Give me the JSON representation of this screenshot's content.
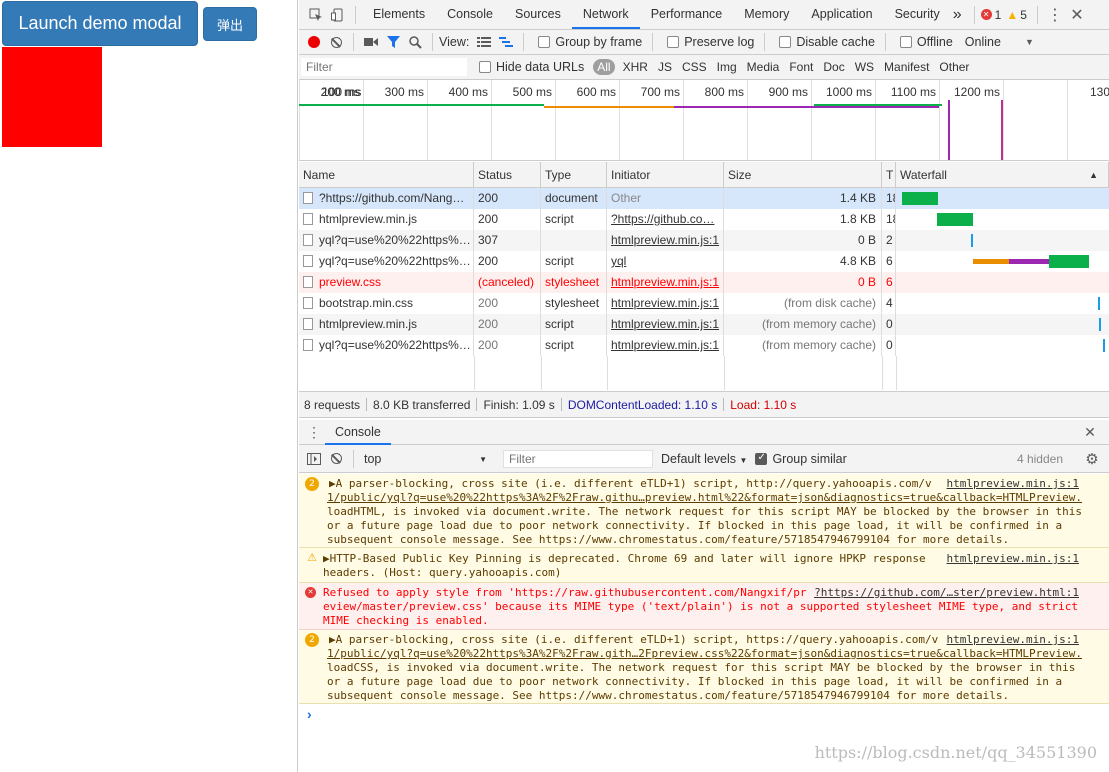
{
  "left": {
    "launch_button": "Launch demo modal",
    "popup_button": "弹出"
  },
  "devtools": {
    "tabs": [
      "Elements",
      "Console",
      "Sources",
      "Network",
      "Performance",
      "Memory",
      "Application",
      "Security"
    ],
    "active_tab": "Network",
    "more_tabs": "»",
    "error_count": "1",
    "warning_count": "5",
    "toolbar": {
      "view_label": "View:",
      "group_by_frame": "Group by frame",
      "preserve_log": "Preserve log",
      "disable_cache": "Disable cache",
      "offline": "Offline",
      "throttle": "Online"
    },
    "filter_bar": {
      "placeholder": "Filter",
      "hide_data_urls": "Hide data URLs",
      "types": [
        "All",
        "XHR",
        "JS",
        "CSS",
        "Img",
        "Media",
        "Font",
        "Doc",
        "WS",
        "Manifest",
        "Other"
      ]
    },
    "timeline_ticks": [
      "100 ms",
      "200 ms",
      "300 ms",
      "400 ms",
      "500 ms",
      "600 ms",
      "700 ms",
      "800 ms",
      "900 ms",
      "1000 ms",
      "1100 ms",
      "1200 ms",
      "130"
    ],
    "columns": [
      "Name",
      "Status",
      "Type",
      "Initiator",
      "Size",
      "T",
      "Waterfall"
    ],
    "requests": [
      {
        "name": "?https://github.com/Nang…",
        "status": "200",
        "type": "document",
        "initiator": "Other",
        "size": "1.4 KB",
        "t": "18"
      },
      {
        "name": "htmlpreview.min.js",
        "status": "200",
        "type": "script",
        "initiator": "?https://github.co…",
        "size": "1.8 KB",
        "t": "18"
      },
      {
        "name": "yql?q=use%20%22https%…",
        "status": "307",
        "type": "",
        "initiator": "htmlpreview.min.js:1",
        "size": "0 B",
        "t": "2"
      },
      {
        "name": "yql?q=use%20%22https%…",
        "status": "200",
        "type": "script",
        "initiator": "yql",
        "size": "4.8 KB",
        "t": "6"
      },
      {
        "name": "preview.css",
        "status": "(canceled)",
        "type": "stylesheet",
        "initiator": "htmlpreview.min.js:1",
        "size": "0 B",
        "t": "6"
      },
      {
        "name": "bootstrap.min.css",
        "status": "200",
        "type": "stylesheet",
        "initiator": "htmlpreview.min.js:1",
        "size": "(from disk cache)",
        "t": "4"
      },
      {
        "name": "htmlpreview.min.js",
        "status": "200",
        "type": "script",
        "initiator": "htmlpreview.min.js:1",
        "size": "(from memory cache)",
        "t": "0"
      },
      {
        "name": "yql?q=use%20%22https%…",
        "status": "200",
        "type": "script",
        "initiator": "htmlpreview.min.js:1",
        "size": "(from memory cache)",
        "t": "0"
      }
    ],
    "summary": {
      "requests": "8 requests",
      "transferred": "8.0 KB transferred",
      "finish": "Finish: 1.09 s",
      "dcl": "DOMContentLoaded: 1.10 s",
      "load": "Load: 1.10 s"
    },
    "console_drawer": {
      "tab": "Console",
      "context": "top",
      "filter_placeholder": "Filter",
      "levels": "Default levels",
      "group_similar": "Group similar",
      "hidden": "4 hidden"
    },
    "messages": [
      {
        "kind": "warn",
        "badge": "2",
        "lines": [
          "▶A parser-blocking, cross site (i.e. different eTLD+1) script, http://query.yahooapis.com/v",
          "1/public/yql?q=use%20%22https%3A%2F%2Fraw.githu…preview.html%22&format=json&diagnostics=true&callback=HTMLPreview.",
          "loadHTML, is invoked via document.write. The network request for this script MAY be blocked by the browser in this",
          "or a future page load due to poor network connectivity. If blocked in this page load, it will be confirmed in a",
          "subsequent console message. See https://www.chromestatus.com/feature/5718547946799104 for more details."
        ],
        "source": "htmlpreview.min.js:1"
      },
      {
        "kind": "warn",
        "badge": "⚠",
        "lines": [
          "▶HTTP-Based Public Key Pinning is deprecated. Chrome 69 and later will ignore HPKP response",
          "headers. (Host: query.yahooapis.com)"
        ],
        "source": "htmlpreview.min.js:1"
      },
      {
        "kind": "err",
        "badge": "✕",
        "lines": [
          "Refused to apply style from 'https://raw.githubusercontent.com/Nangxif/pr",
          "eview/master/preview.css' because its MIME type ('text/plain') is not a supported stylesheet MIME type, and strict",
          "MIME checking is enabled."
        ],
        "source": "?https://github.com/…ster/preview.html:1"
      },
      {
        "kind": "warn",
        "badge": "2",
        "lines": [
          "▶A parser-blocking, cross site (i.e. different eTLD+1) script, https://query.yahooapis.com/v",
          "1/public/yql?q=use%20%22https%3A%2F%2Fraw.gith…2Fpreview.css%22&format=json&diagnostics=true&callback=HTMLPreview.",
          "loadCSS, is invoked via document.write. The network request for this script MAY be blocked by the browser in this",
          "or a future page load due to poor network connectivity. If blocked in this page load, it will be confirmed in a",
          "subsequent console message. See https://www.chromestatus.com/feature/5718547946799104 for more details."
        ],
        "source": "htmlpreview.min.js:1"
      }
    ],
    "prompt": "›"
  },
  "watermark": "https://blog.csdn.net/qq_34551390",
  "colors": {
    "accent": "#1a73e8",
    "primary_button": "#337ab7",
    "red_box": "#ff0000",
    "error": "#ff0000",
    "dcl": "#1a1aa6",
    "load": "#d00000"
  }
}
